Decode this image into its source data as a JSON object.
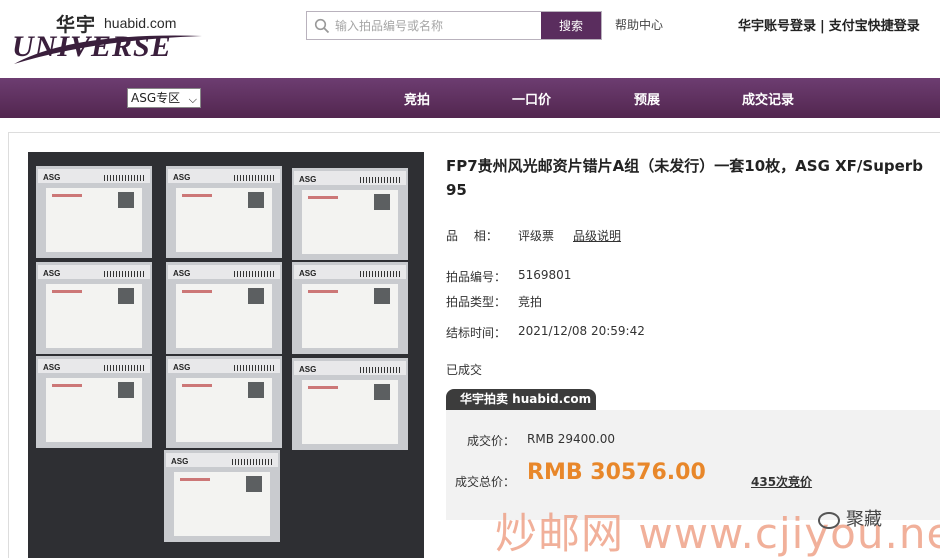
{
  "header": {
    "logo_cn": "华宇",
    "logo_domain": "huabid.com",
    "logo_word": "UNIVERSE",
    "search_placeholder": "输入拍品编号或名称",
    "search_button": "搜索",
    "help": "帮助中心",
    "login_huayu": "华宇账号登录",
    "login_separator": "|",
    "login_alipay": "支付宝快捷登录"
  },
  "nav": {
    "zone_select": "ASG专区",
    "items": [
      "竞拍",
      "一口价",
      "预展",
      "成交记录"
    ]
  },
  "lot": {
    "title": "FP7贵州风光邮资片错片A组（未发行）一套10枚，ASG XF/Superb 95",
    "grade_label": "品　 相：",
    "grade_value": "评级票",
    "grade_link": "品级说明",
    "lot_no_label": "拍品编号：",
    "lot_no_value": "5169801",
    "lot_type_label": "拍品类型：",
    "lot_type_value": "竞拍",
    "end_time_label": "结标时间：",
    "end_time_value": "2021/12/08 20:59:42",
    "status": "已成交",
    "brand_tab": "华宇拍卖 huabid.com",
    "deal_price_label": "成交价：",
    "deal_price_value": "RMB 29400.00",
    "total_price_label": "成交总价：",
    "total_price_value": "RMB 30576.00",
    "bid_count": "435次竞价",
    "card_slab_label": "ASG"
  },
  "watermark": {
    "site": "炒邮网 www.cjiyou.net",
    "wechat_name": "聚藏"
  },
  "colors": {
    "nav_purple": "#5a2d5e",
    "price_orange": "#e8872a"
  }
}
